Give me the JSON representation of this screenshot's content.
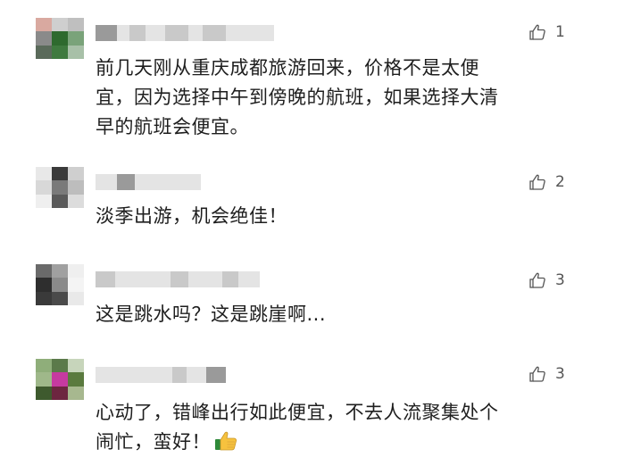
{
  "comments": [
    {
      "likes": "1",
      "text": "前几天刚从重庆成都旅游回来，价格不是太便宜，因为选择中午到傍晚的航班，如果选择大清早的航班会便宜。",
      "lines": [
        "前几天刚从重庆成都旅游回来，价格不是太便",
        "宜，因为选择中午到傍晚的航班，如果选择大清",
        "早的航班会便宜。"
      ],
      "avatar_colors": [
        "#d9a9a0",
        "#cfcfcf",
        "#bfbfbf",
        "#8a8a8a",
        "#2e6a2e",
        "#7aa37a",
        "#5a6a5a",
        "#3f7a3f",
        "#a8c0a8"
      ]
    },
    {
      "likes": "2",
      "text": "淡季出游，机会绝佳！",
      "lines": [
        "淡季出游，机会绝佳！"
      ],
      "avatar_colors": [
        "#e8e8e8",
        "#3a3a3a",
        "#cfcfcf",
        "#d8d8d8",
        "#7a7a7a",
        "#bdbdbd",
        "#efefef",
        "#5a5a5a",
        "#dcdcdc"
      ]
    },
    {
      "likes": "3",
      "text": "这是跳水吗？这是跳崖啊...",
      "lines": [
        "这是跳水吗？这是跳崖啊..."
      ],
      "avatar_colors": [
        "#6a6a6a",
        "#a0a0a0",
        "#efefef",
        "#2e2e2e",
        "#8a8a8a",
        "#f4f4f4",
        "#3a3a3a",
        "#4a4a4a",
        "#e9e9e9"
      ]
    },
    {
      "likes": "3",
      "text": "心动了，错峰出行如此便宜，不去人流聚集处个闹忙，蛮好！",
      "lines": [
        "心动了，错峰出行如此便宜，不去人流聚集处个",
        "闹忙，蛮好！"
      ],
      "avatar_colors": [
        "#8fae7a",
        "#5b7a4a",
        "#c7d5bb",
        "#9fb88a",
        "#c63aa0",
        "#5a7a3e",
        "#3e5a2e",
        "#6d2640",
        "#a7b88f"
      ]
    }
  ],
  "icons": {
    "like": "thumbs-up-outline-icon",
    "emoji": "thumbs-up-emoji-icon"
  }
}
